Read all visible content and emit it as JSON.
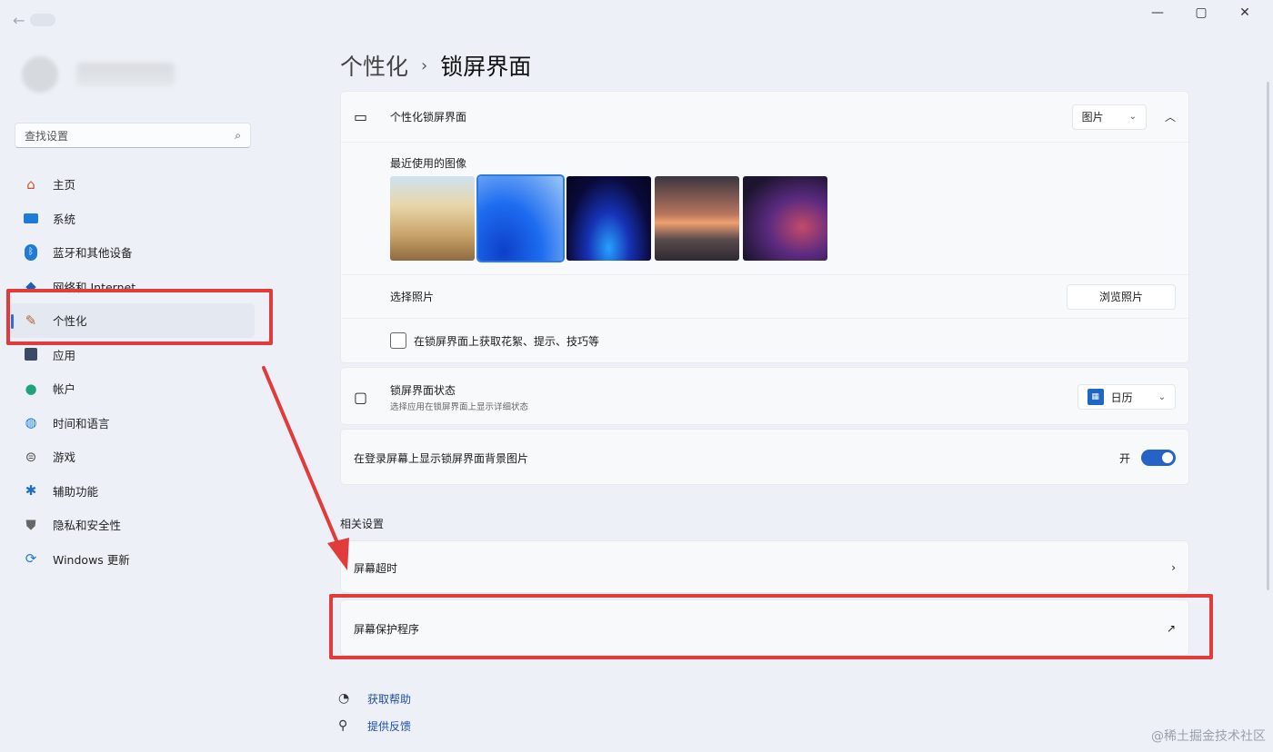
{
  "titlebar": {
    "back": "←",
    "controls": [
      "—",
      "▢",
      "✕"
    ]
  },
  "sidebar": {
    "search_placeholder": "查找设置",
    "items": [
      {
        "label": "主页",
        "icon": "home-icon"
      },
      {
        "label": "系统",
        "icon": "monitor-icon"
      },
      {
        "label": "蓝牙和其他设备",
        "icon": "bluetooth-icon"
      },
      {
        "label": "网络和 Internet",
        "icon": "network-icon"
      },
      {
        "label": "个性化",
        "icon": "brush-icon"
      },
      {
        "label": "应用",
        "icon": "apps-icon"
      },
      {
        "label": "帐户",
        "icon": "person-icon"
      },
      {
        "label": "时间和语言",
        "icon": "globe-icon"
      },
      {
        "label": "游戏",
        "icon": "gamepad-icon"
      },
      {
        "label": "辅助功能",
        "icon": "accessibility-icon"
      },
      {
        "label": "隐私和安全性",
        "icon": "shield-icon"
      },
      {
        "label": "Windows 更新",
        "icon": "update-icon"
      }
    ]
  },
  "header": {
    "parent": "个性化",
    "separator": "›",
    "current": "锁屏界面"
  },
  "lock_screen": {
    "label": "个性化锁屏界面",
    "dropdown_value": "图片",
    "recent_label": "最近使用的图像",
    "choose_label": "选择照片",
    "browse_button": "浏览照片",
    "tips_label": "在锁屏界面上获取花絮、提示、技巧等"
  },
  "lock_status": {
    "title": "锁屏界面状态",
    "subtitle": "选择应用在锁屏界面上显示详细状态",
    "dropdown_value": "日历"
  },
  "login_bg": {
    "label": "在登录屏幕上显示锁屏界面背景图片",
    "toggle_text": "开"
  },
  "related": {
    "title": "相关设置",
    "timeout": "屏幕超时",
    "screensaver": "屏幕保护程序"
  },
  "links": {
    "help": "获取帮助",
    "feedback": "提供反馈"
  },
  "watermark": "@稀土掘金技术社区",
  "colors": {
    "accent": "#2563c8",
    "annotation": "#e23b3b"
  }
}
